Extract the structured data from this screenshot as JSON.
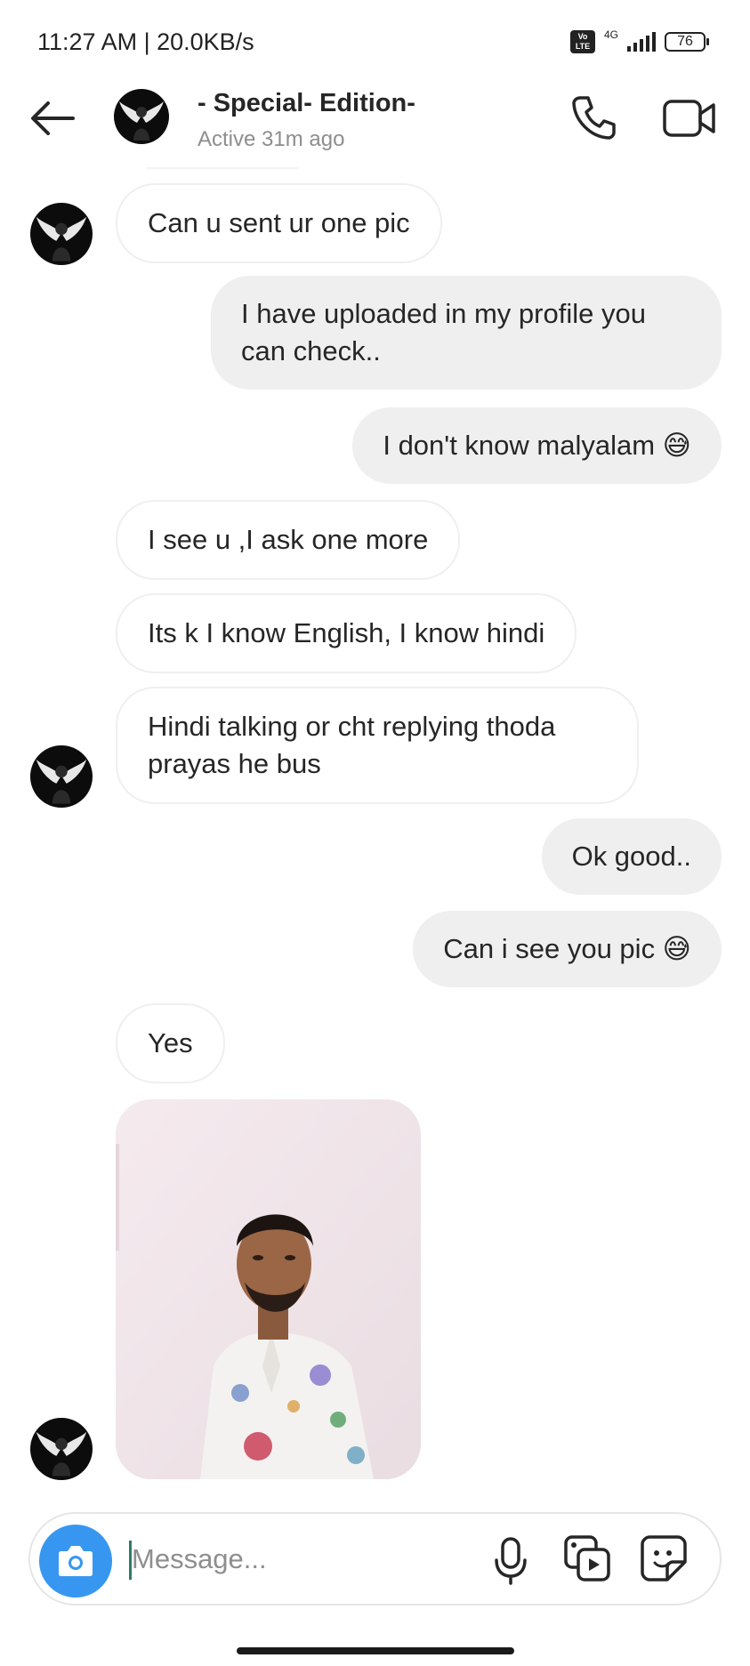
{
  "status_bar": {
    "time": "11:27 AM | 20.0KB/s",
    "volte": "Vo LTE",
    "network": "4G",
    "battery": "76"
  },
  "header": {
    "contact_name": "- Special- Edition-",
    "contact_status": "Active 31m ago",
    "icons": [
      "back-arrow-icon",
      "phone-icon",
      "video-camera-icon"
    ]
  },
  "messages": [
    {
      "direction": "in",
      "text": "Can u sent ur one pic"
    },
    {
      "direction": "out",
      "text": "I have uploaded in my profile you can check.."
    },
    {
      "direction": "out",
      "text": "I don't know malyalam 😅"
    },
    {
      "direction": "in",
      "text": "I see u ,I ask one more"
    },
    {
      "direction": "in",
      "text": "Its k I know English,  I know hindi"
    },
    {
      "direction": "in",
      "text": "Hindi talking or cht replying thoda prayas he bus"
    },
    {
      "direction": "out",
      "text": "Ok good.."
    },
    {
      "direction": "out",
      "text": "Can i see you pic 😅"
    },
    {
      "direction": "in",
      "text": "Yes"
    },
    {
      "direction": "in",
      "type": "photo"
    }
  ],
  "composer": {
    "placeholder": "Message...",
    "value": "",
    "icons": [
      "camera-icon",
      "microphone-icon",
      "gallery-icon",
      "sticker-icon"
    ]
  },
  "colors": {
    "accent": "#3797f0",
    "outgoing_bubble": "#efefef",
    "incoming_border": "#efefef",
    "secondary_text": "#8e8e8e"
  }
}
